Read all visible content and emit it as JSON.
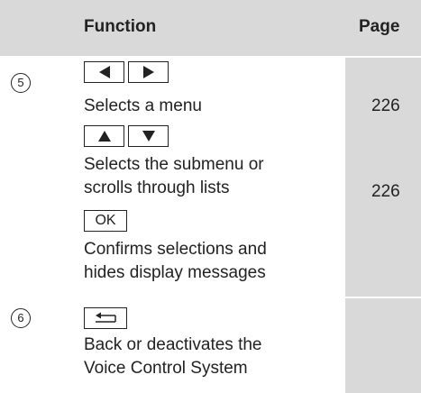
{
  "header": {
    "function_label": "Function",
    "page_label": "Page"
  },
  "rows": [
    {
      "marker": "5",
      "items": [
        {
          "keys": [
            "left-arrow-key",
            "right-arrow-key"
          ],
          "description": "Selects a menu",
          "page": "226"
        },
        {
          "keys": [
            "up-arrow-key",
            "down-arrow-key"
          ],
          "description_lines": [
            "Selects the submenu or",
            "scrolls through lists"
          ],
          "page": "226"
        },
        {
          "key_text": "OK",
          "description_lines": [
            "Confirms selections and",
            "hides display messages"
          ]
        }
      ]
    },
    {
      "marker": "6",
      "items": [
        {
          "keys": [
            "back-key"
          ],
          "description_lines": [
            "Back or deactivates the",
            "Voice Control System"
          ]
        }
      ]
    }
  ]
}
